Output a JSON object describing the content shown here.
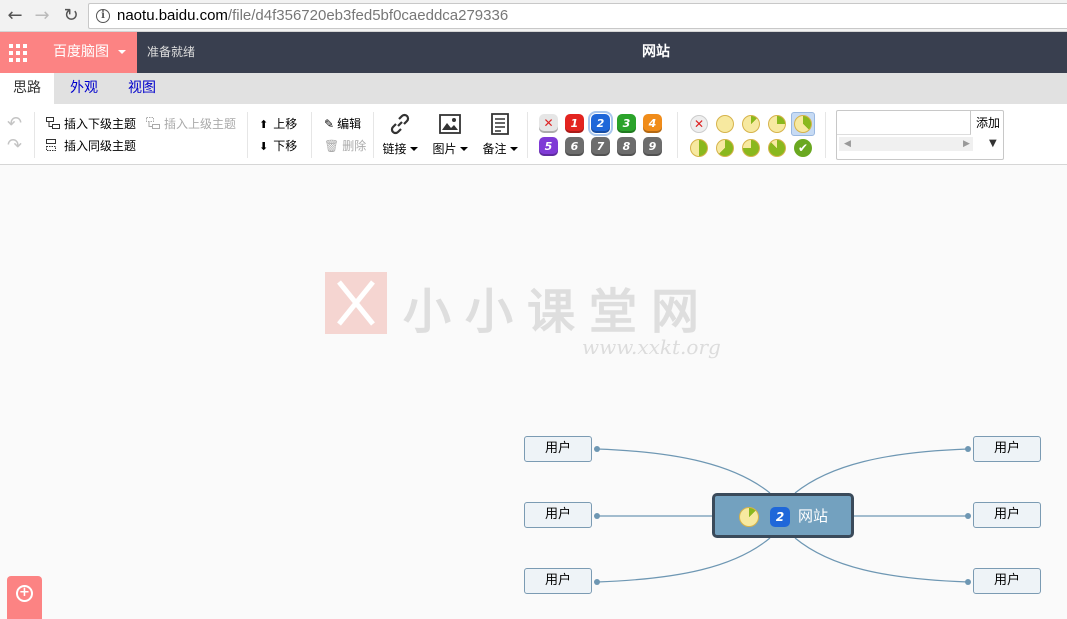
{
  "browser": {
    "url_host": "naotu.baidu.com",
    "url_path": "/file/d4f356720eb3fed5bf0caeddca279336"
  },
  "app": {
    "brand": "百度脑图",
    "status": "准备就绪",
    "title": "网站"
  },
  "tabs": [
    {
      "label": "思路",
      "active": true
    },
    {
      "label": "外观",
      "active": false
    },
    {
      "label": "视图",
      "active": false
    }
  ],
  "toolbar": {
    "insert_child": "插入下级主题",
    "insert_parent": "插入上级主题",
    "insert_sibling": "插入同级主题",
    "move_up": "上移",
    "move_down": "下移",
    "edit": "编辑",
    "delete": "删除",
    "link": "链接",
    "image": "图片",
    "note": "备注",
    "priorities": [
      "1",
      "2",
      "3",
      "4",
      "5",
      "6",
      "7",
      "8",
      "9"
    ],
    "selected_priority": "2",
    "add_label": "添加"
  },
  "colors": {
    "accent": "#fc8383",
    "appbar": "#393f4f",
    "priority_colors": [
      "#e32420",
      "#1f67d9",
      "#2ba32b",
      "#f08c1a",
      "#7f3ad6",
      "#6d6d6d",
      "#6d6d6d",
      "#6d6d6d",
      "#6d6d6d"
    ]
  },
  "watermark": {
    "text": "小小课堂网",
    "url": "www.xxkt.org"
  },
  "mindmap": {
    "root": {
      "label": "网站",
      "priority": "2",
      "progress": "1/8"
    },
    "children": [
      {
        "label": "用户",
        "side": "left"
      },
      {
        "label": "用户",
        "side": "left"
      },
      {
        "label": "用户",
        "side": "left"
      },
      {
        "label": "用户",
        "side": "right"
      },
      {
        "label": "用户",
        "side": "right"
      },
      {
        "label": "用户",
        "side": "right"
      }
    ]
  }
}
